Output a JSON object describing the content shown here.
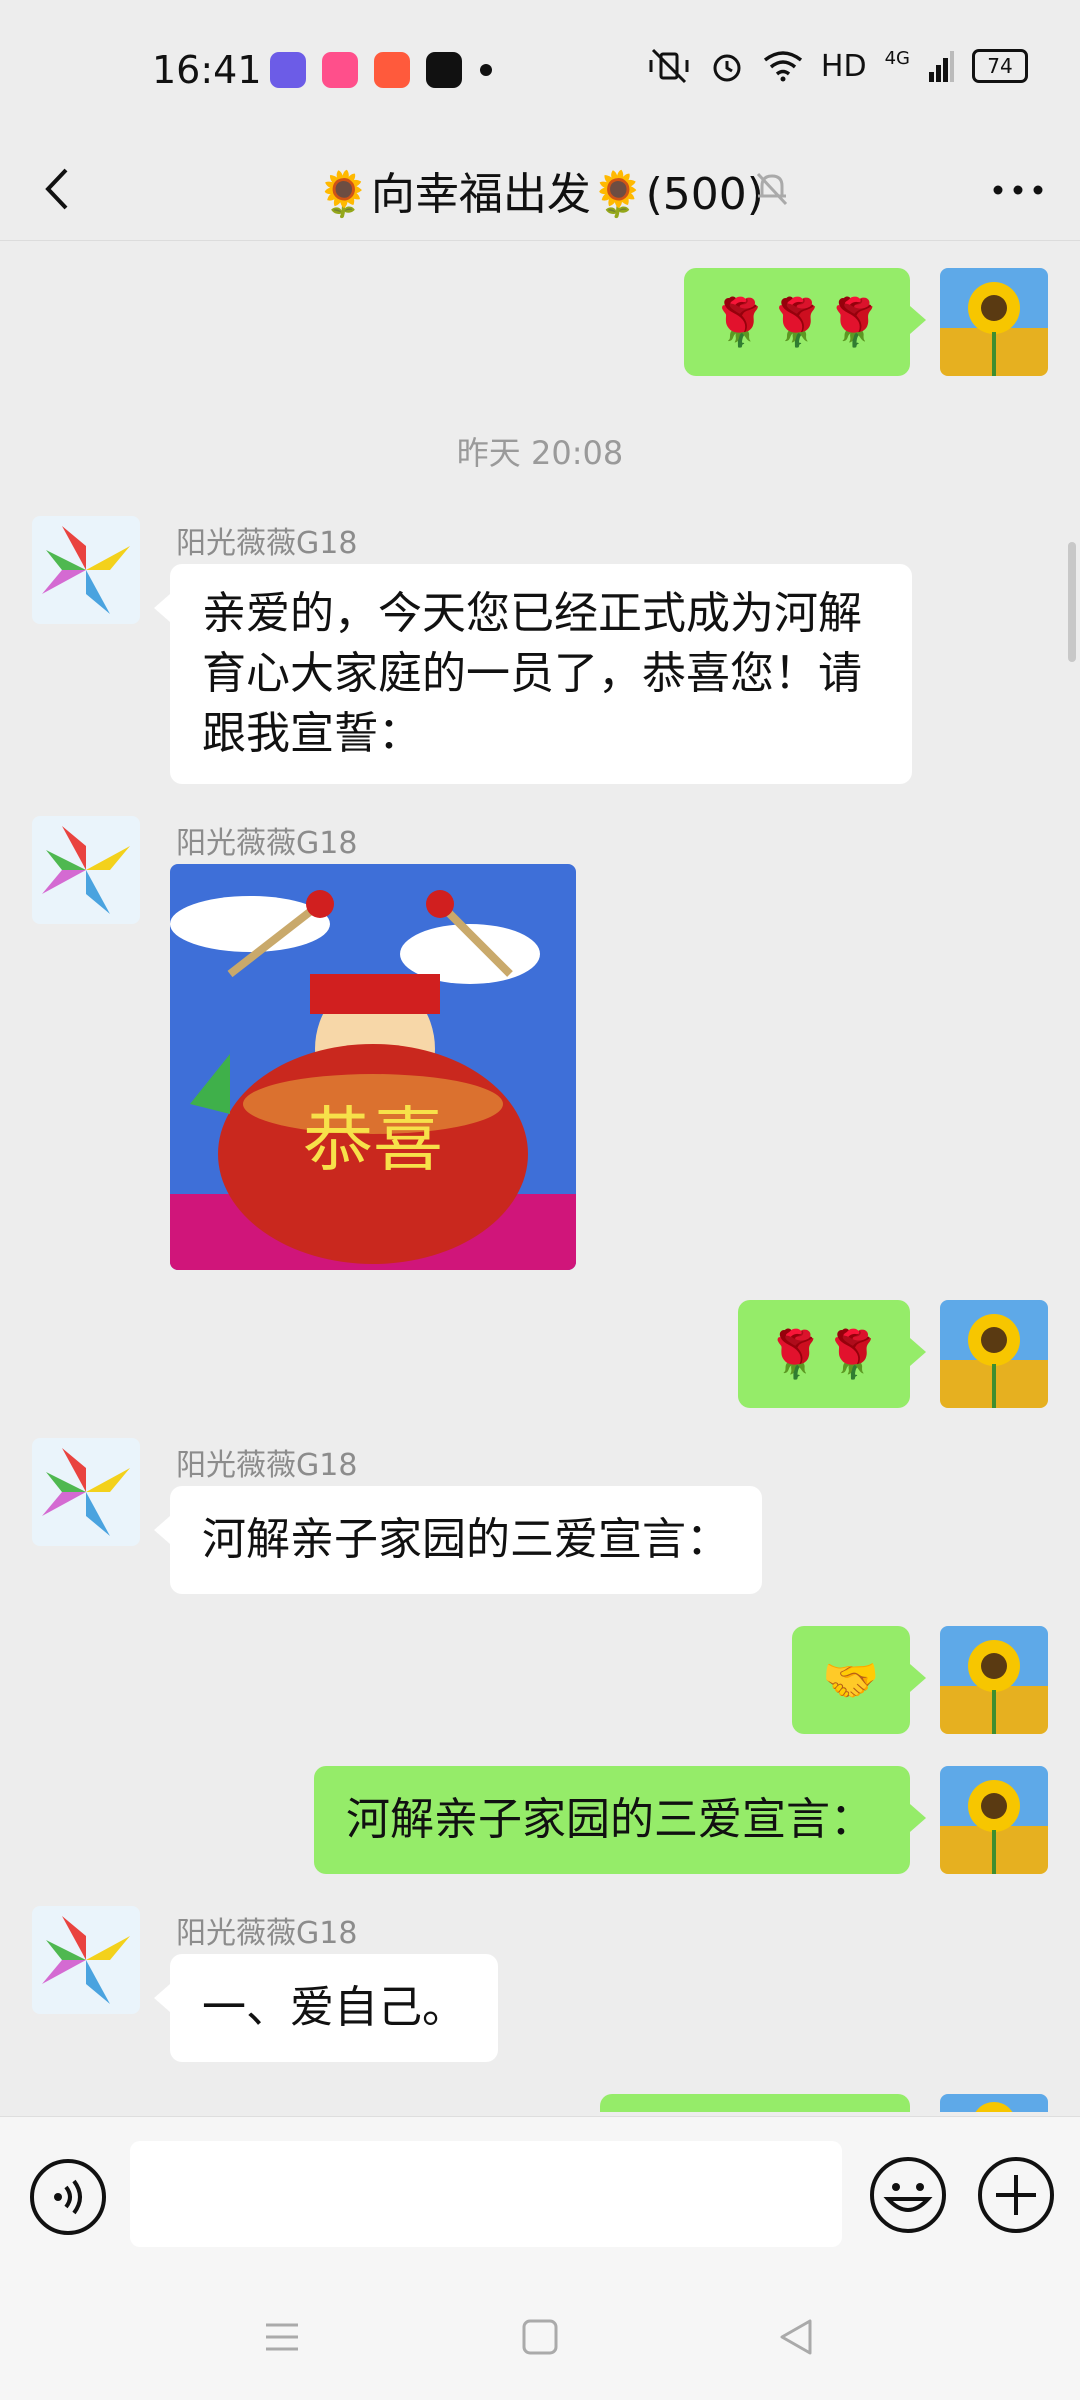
{
  "status_bar": {
    "time": "16:41",
    "network": "HD",
    "signal": "4G",
    "battery": "74",
    "icons": [
      "mute-vibrate-icon",
      "alarm-icon",
      "wifi-icon",
      "signal-icon"
    ]
  },
  "header": {
    "title": "🌻向幸福出发🌻(500)",
    "icons": [
      "back-icon",
      "mute-notification-icon",
      "more-icon"
    ]
  },
  "chat": {
    "time_separator": "昨天 20:08",
    "messages": [
      {
        "side": "right",
        "type": "emoji",
        "text": "🌹🌹🌹"
      },
      {
        "side": "left",
        "sender": "阳光薇薇G18",
        "type": "text",
        "text": "亲爱的，今天您已经正式成为河解育心大家庭的一员了，恭喜您！请跟我宣誓："
      },
      {
        "side": "left",
        "sender": "阳光薇薇G18",
        "type": "sticker",
        "text": "恭喜"
      },
      {
        "side": "right",
        "type": "emoji",
        "text": "🌹🌹"
      },
      {
        "side": "left",
        "sender": "阳光薇薇G18",
        "type": "text",
        "text": "河解亲子家园的三爱宣言："
      },
      {
        "side": "right",
        "type": "emoji",
        "text": "🤝"
      },
      {
        "side": "right",
        "type": "text",
        "text": "河解亲子家园的三爱宣言："
      },
      {
        "side": "left",
        "sender": "阳光薇薇G18",
        "type": "text",
        "text": "一、爱自己。"
      }
    ]
  },
  "input_bar": {
    "value": "",
    "icons": [
      "voice-icon",
      "emoji-icon",
      "plus-icon"
    ]
  },
  "colors": {
    "background": "#ededed",
    "sent_bubble": "#95ec69",
    "received_bubble": "#ffffff"
  }
}
